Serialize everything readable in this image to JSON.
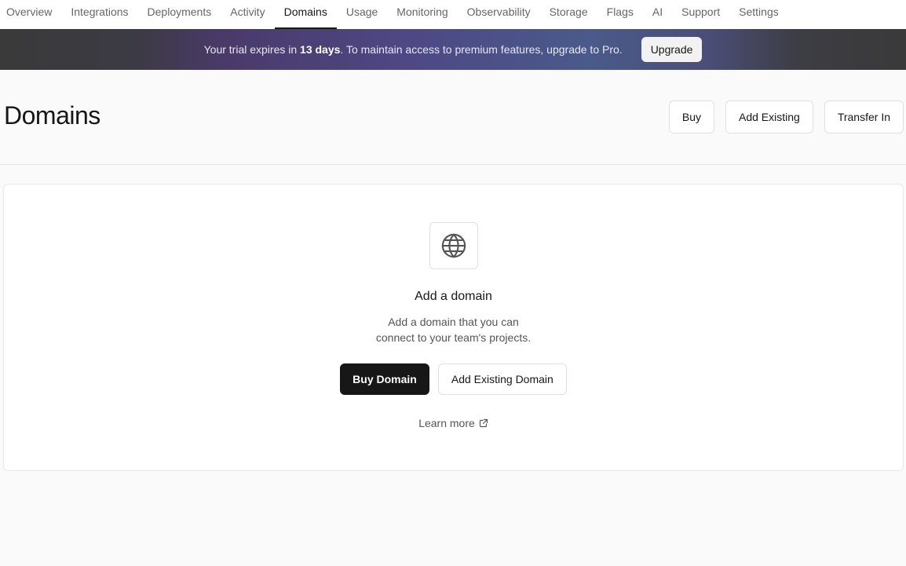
{
  "nav": {
    "tabs": [
      {
        "label": "Overview"
      },
      {
        "label": "Integrations"
      },
      {
        "label": "Deployments"
      },
      {
        "label": "Activity"
      },
      {
        "label": "Domains"
      },
      {
        "label": "Usage"
      },
      {
        "label": "Monitoring"
      },
      {
        "label": "Observability"
      },
      {
        "label": "Storage"
      },
      {
        "label": "Flags"
      },
      {
        "label": "AI"
      },
      {
        "label": "Support"
      },
      {
        "label": "Settings"
      }
    ],
    "active_tab": "Domains"
  },
  "banner": {
    "text_prefix": "Your trial expires in ",
    "text_bold": "13 days",
    "text_suffix": ". To maintain access to premium features, upgrade to Pro.",
    "upgrade_label": "Upgrade"
  },
  "header": {
    "title": "Domains",
    "buy_label": "Buy",
    "add_existing_label": "Add Existing",
    "transfer_in_label": "Transfer In"
  },
  "empty_state": {
    "icon": "globe-icon",
    "title": "Add a domain",
    "description_line1": "Add a domain that you can",
    "description_line2": "connect to your team's projects.",
    "buy_domain_label": "Buy Domain",
    "add_existing_domain_label": "Add Existing Domain",
    "learn_more_label": "Learn more",
    "learn_more_icon": "external-link-icon"
  },
  "colors": {
    "primary_button": "#171717",
    "page_background": "#fafafa",
    "banner_accent": "#4e4884"
  }
}
